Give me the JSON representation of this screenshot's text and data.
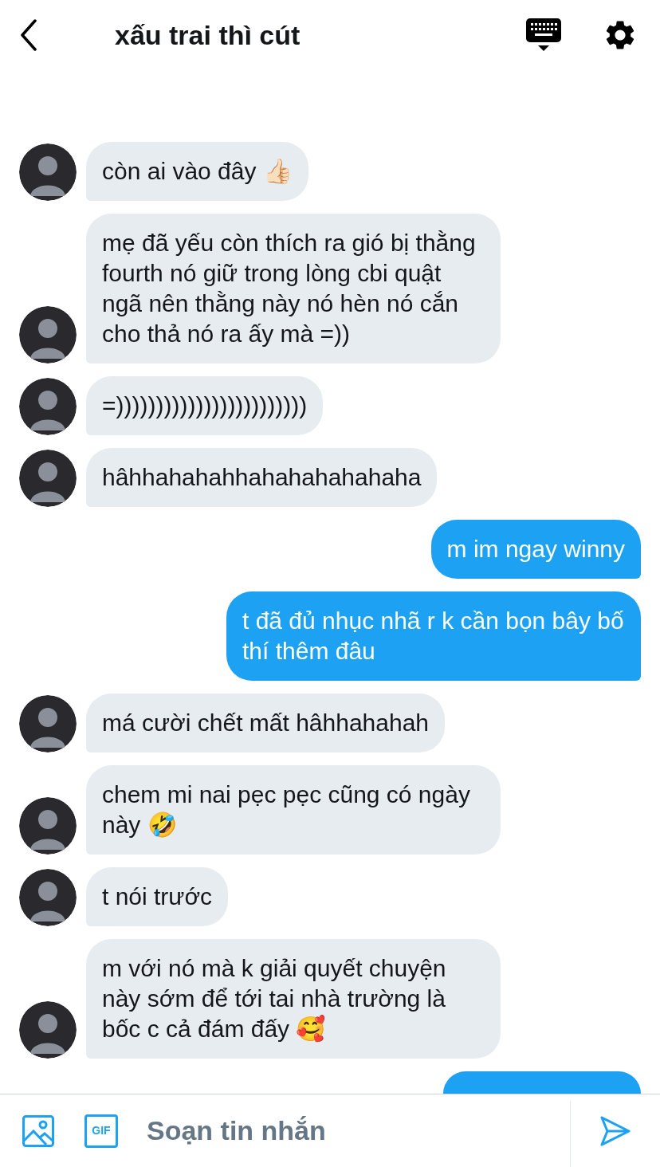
{
  "header": {
    "title": "xấu trai thì cút"
  },
  "messages": [
    {
      "kind": "received",
      "text": "còn ai vào đây 👍🏻"
    },
    {
      "kind": "received",
      "text": "mẹ đã yếu còn thích ra gió bị thằng fourth nó giữ trong lòng cbi quật ngã nên thằng này nó hèn nó cắn cho thả nó ra ấy mà =))"
    },
    {
      "kind": "received",
      "text": "=))))))))))))))))))))))))"
    },
    {
      "kind": "received",
      "text": "hâhhahahahhahahahahahaha"
    },
    {
      "kind": "sent",
      "text": "m im ngay winny"
    },
    {
      "kind": "sent",
      "text": "t đã đủ nhục nhã r k cần bọn bây bố thí thêm đâu"
    },
    {
      "kind": "received",
      "text": "má cười chết mất hâhhahahah"
    },
    {
      "kind": "received",
      "text": "chem mi nai pẹc pẹc cũng có ngày này 🤣"
    },
    {
      "kind": "received",
      "text": "t nói trước"
    },
    {
      "kind": "received",
      "text": "m với nó mà k giải quyết chuyện này sớm để tới tai nhà trường là bốc c cả đám đấy 🥰"
    },
    {
      "kind": "sent_clipped"
    }
  ],
  "composer": {
    "gif_label": "GIF",
    "placeholder": "Soạn tin nhắn"
  }
}
